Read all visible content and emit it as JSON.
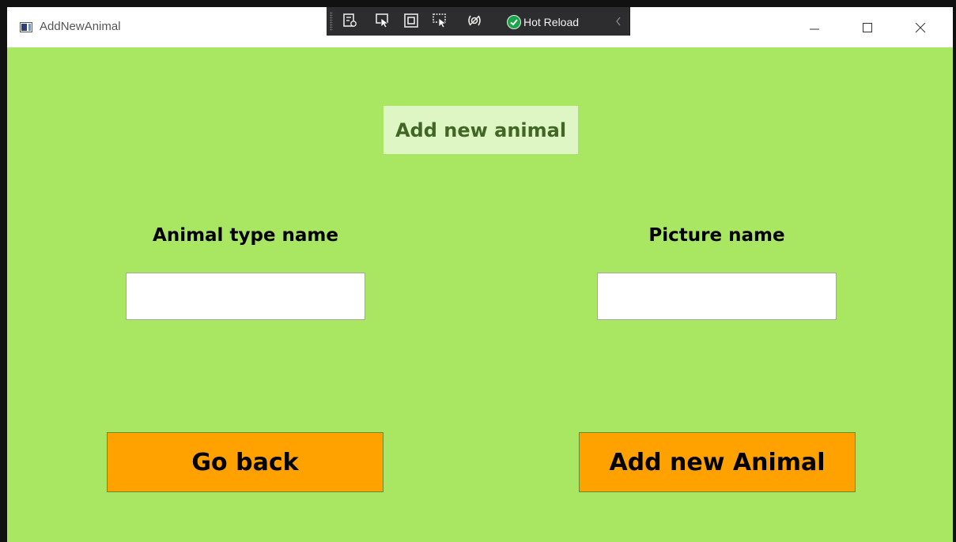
{
  "window": {
    "title": "AddNewAnimal",
    "background_color": "#a9e662",
    "icon": "window-app-icon"
  },
  "debug_toolbar": {
    "tools": [
      {
        "name": "go-to-live-visual-tree-icon"
      },
      {
        "name": "select-element-icon"
      },
      {
        "name": "display-layout-adorners-icon"
      },
      {
        "name": "track-focused-element-icon"
      },
      {
        "name": "binding-failures-icon"
      }
    ],
    "hot_reload_label": "Hot Reload",
    "hot_reload_status": "ok"
  },
  "window_controls": {
    "minimize": "minimize-icon",
    "maximize": "maximize-icon",
    "close": "close-icon"
  },
  "page": {
    "heading": "Add new animal",
    "heading_color": "#416625",
    "heading_background": "#def5c4"
  },
  "form": {
    "animal_type_label": "Animal type name",
    "animal_type_value": "",
    "picture_label": "Picture name",
    "picture_value": ""
  },
  "actions": {
    "go_back_label": "Go back",
    "add_label": "Add new Animal",
    "button_color": "#ffa200"
  }
}
